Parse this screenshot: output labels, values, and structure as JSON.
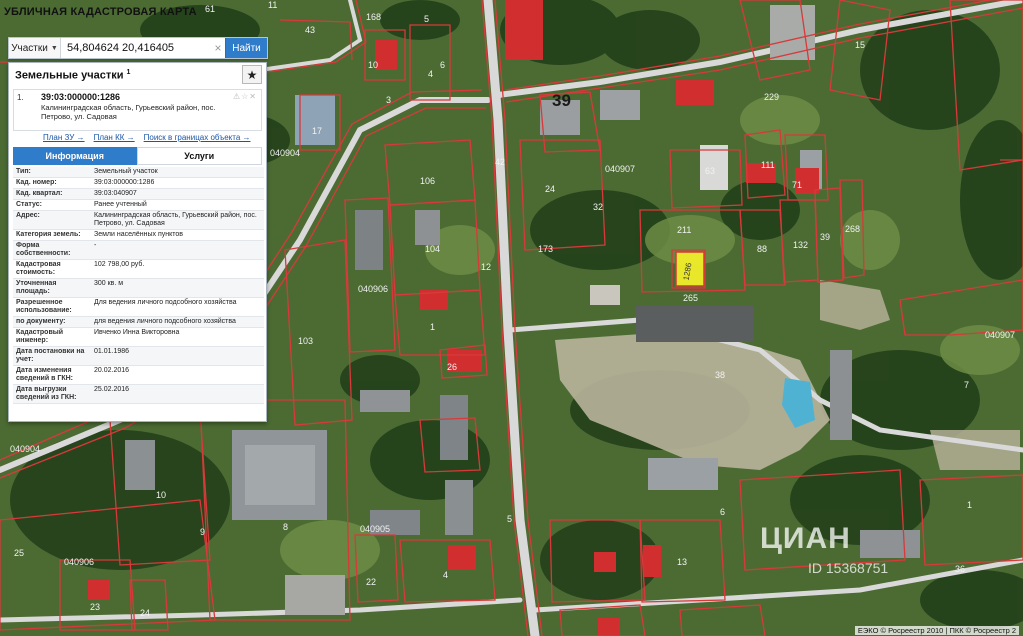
{
  "header": {
    "title": "УБЛИЧНАЯ КАДАСТРОВАЯ КАРТА"
  },
  "search": {
    "type_label": "Участки",
    "value": "54,804624 20,416405",
    "clear_label": "×",
    "button_label": "Найти"
  },
  "panel": {
    "title": "Земельные участки",
    "title_count": "1",
    "star_label": "★",
    "result": {
      "index": "1.",
      "cad_number": "39:03:000000:1286",
      "address_line": "Калининградская область, Гурьевский район, пос. Петрово, ул. Садовая",
      "tools": "⚠☆✕"
    },
    "links": [
      "План ЗУ →",
      "План КК →",
      "Поиск в границах объекта →"
    ],
    "tabs": [
      "Информация",
      "Услуги"
    ],
    "rows": [
      {
        "key": "Тип:",
        "value": "Земельный участок"
      },
      {
        "key": "Кад. номер:",
        "value": "39:03:000000:1286"
      },
      {
        "key": "Кад. квартал:",
        "value": "39:03:040907"
      },
      {
        "key": "Статус:",
        "value": "Ранее учтенный"
      },
      {
        "key": "Адрес:",
        "value": "Калининградская область, Гурьевский район, пос. Петрово, ул. Садовая"
      },
      {
        "key": "Категория земель:",
        "value": "Земли населённых пунктов"
      },
      {
        "key": "Форма собственности:",
        "value": "-"
      },
      {
        "key": "Кадастровая стоимость:",
        "value": "102 798,00 руб."
      },
      {
        "key": "Уточненная площадь:",
        "value": "300 кв. м"
      },
      {
        "key": "Разрешенное использование:",
        "value": "Для ведения личного подсобного хозяйства"
      },
      {
        "key": "по документу:",
        "value": "для ведения личного подсобного хозяйства"
      },
      {
        "key": "Кадастровый инженер:",
        "value": "Ивченко Инна Викторовна"
      },
      {
        "key": "Дата постановки на учет:",
        "value": "01.01.1986"
      },
      {
        "key": "Дата изменения сведений в ГКН:",
        "value": "20.02.2016"
      },
      {
        "key": "Дата выгрузки сведений из ГКН:",
        "value": "25.02.2016"
      }
    ]
  },
  "map": {
    "big_label": "39",
    "selected_label": "1286",
    "quarter_labels": [
      "040907",
      "040904",
      "040906",
      "040905",
      "040906",
      "040907",
      "040904"
    ],
    "parcel_labels": [
      "43",
      "168",
      "5",
      "6",
      "61",
      "11",
      "15",
      "10",
      "4",
      "3",
      "229",
      "17",
      "211",
      "111",
      "71",
      "42",
      "12",
      "24",
      "173",
      "63",
      "106",
      "104",
      "88",
      "132",
      "39",
      "268",
      "32",
      "265",
      "1",
      "103",
      "26",
      "38",
      "9",
      "10",
      "8",
      "25",
      "4",
      "5",
      "22",
      "13",
      "6",
      "1",
      "36",
      "24",
      "23",
      "7"
    ],
    "colors": {
      "boundary": "#d63a3a",
      "road": "#e8e8e8",
      "selected": "#f2ee2a",
      "roof_red": "#d62d2d"
    }
  },
  "watermark": {
    "logo": "ЦИАН",
    "id": "ID 15368751"
  },
  "footer": {
    "copyright": "ЕЭКО © Росреестр 2010 | ПКК © Росреестр 2"
  }
}
